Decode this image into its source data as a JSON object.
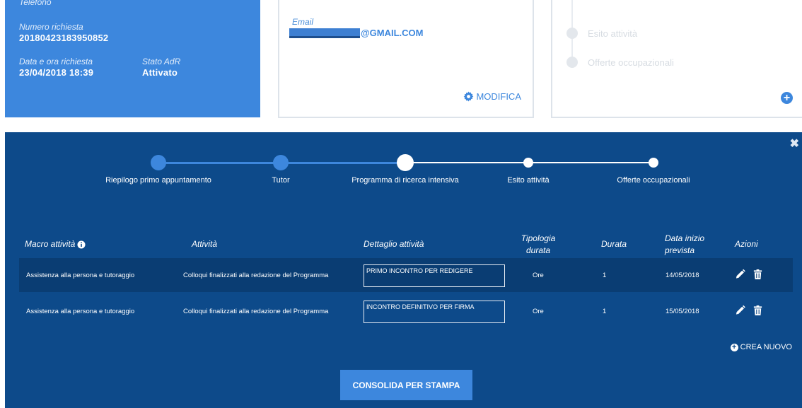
{
  "info_card": {
    "phone_label": "Telefono",
    "request_number_label": "Numero richiesta",
    "request_number": "20180423183950852",
    "date_label": "Data e ora richiesta",
    "date_value": "23/04/2018 18:39",
    "state_label": "Stato AdR",
    "state_value": "Attivato"
  },
  "contact_card": {
    "email_label": "Email",
    "email_value": "@GMAIL.COM",
    "edit_label": "MODIFICA"
  },
  "timeline_card": {
    "items": [
      "Esito attività",
      "Offerte occupazionali"
    ]
  },
  "stepper": {
    "steps": [
      {
        "label": "Riepilogo primo appuntamento",
        "state": "done"
      },
      {
        "label": "Tutor",
        "state": "done"
      },
      {
        "label": "Programma di ricerca intensiva",
        "state": "current"
      },
      {
        "label": "Esito attività",
        "state": "todo"
      },
      {
        "label": "Offerte occupazionali",
        "state": "todo"
      }
    ]
  },
  "table": {
    "headers": {
      "macro": "Macro attività",
      "attivita": "Attività",
      "dettaglio": "Dettaglio attività",
      "tipologia_1": "Tipologia",
      "tipologia_2": "durata",
      "durata": "Durata",
      "data_1": "Data inizio",
      "data_2": "prevista",
      "azioni": "Azioni"
    },
    "rows": [
      {
        "macro": "Assistenza alla persona e tutoraggio",
        "attivita": "Colloqui finalizzati alla redazione del Programma",
        "dettaglio": "PRIMO INCONTRO PER REDIGERE",
        "tipologia": "Ore",
        "durata": "1",
        "data": "14/05/2018"
      },
      {
        "macro": "Assistenza alla persona e tutoraggio",
        "attivita": "Colloqui finalizzati alla redazione del Programma",
        "dettaglio": "INCONTRO DEFINITIVO PER FIRMA",
        "tipologia": "Ore",
        "durata": "1",
        "data": "15/05/2018"
      }
    ]
  },
  "actions": {
    "create_new": "CREA NUOVO",
    "consolidate": "CONSOLIDA PER STAMPA"
  },
  "colors": {
    "primary": "#3d87dd",
    "panel": "#0d4a8a",
    "row_highlight": "#0a3d73"
  }
}
